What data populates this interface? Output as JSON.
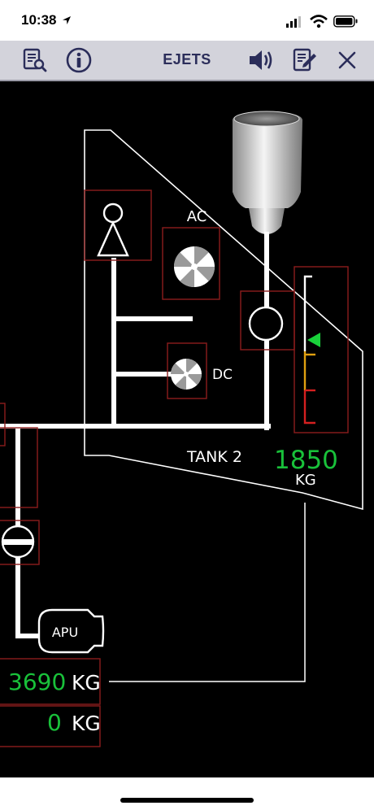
{
  "status_bar": {
    "time": "10:38",
    "location_arrow": "location-arrow-icon",
    "icons": [
      "signal-bars-icon",
      "wifi-icon",
      "battery-icon"
    ]
  },
  "toolbar": {
    "title": "EJETS",
    "left_buttons": [
      "document-search-icon",
      "info-icon"
    ],
    "right_buttons": [
      "speaker-icon",
      "notes-edit-icon",
      "close-icon"
    ]
  },
  "synoptic": {
    "ac_pump_label": "AC",
    "dc_pump_label": "DC",
    "tank_label": "TANK 2",
    "tank_quantity": "1850",
    "tank_unit": "KG",
    "apu_label": "APU",
    "readout_1_value": "3690",
    "readout_1_unit": "KG",
    "readout_2_value": "0",
    "readout_2_unit": "KG"
  },
  "colors": {
    "background": "#000000",
    "line": "#ffffff",
    "fuel_quantity": "#19c13a",
    "box_outline": "#8c1c1c",
    "toolbar": "#d3d3db",
    "toolbar_icon": "#2b2d5a",
    "gauge_caution": "#e0a010",
    "gauge_warning": "#d42020",
    "gauge_pointer": "#19d13a"
  }
}
